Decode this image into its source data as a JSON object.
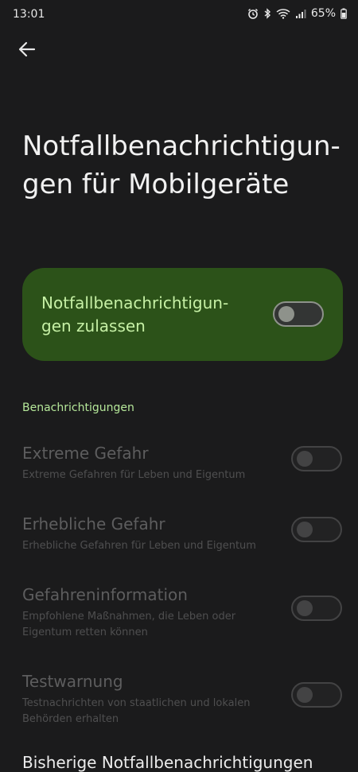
{
  "status_bar": {
    "time": "13:01",
    "battery": "65%",
    "icons": [
      "alarm-icon",
      "bluetooth-icon",
      "wifi-icon",
      "signal-icon",
      "battery-icon"
    ]
  },
  "header": {
    "back_icon": "arrow-left-icon",
    "title": "Notfallbenachrichtigun-\ngen für Mobilgeräte"
  },
  "master": {
    "label": "Notfallbenachrichtigun-\ngen zulassen",
    "enabled": false
  },
  "section": {
    "header": "Benachrichtigungen"
  },
  "settings": [
    {
      "title": "Extreme Gefahr",
      "description": "Extreme Gefahren für Leben und Eigentum",
      "enabled": false
    },
    {
      "title": "Erhebliche Gefahr",
      "description": "Erhebliche Gefahren für Leben und Eigentum",
      "enabled": false
    },
    {
      "title": "Gefahreninformation",
      "description": "Empfohlene Maßnahmen, die Leben oder Eigentum retten können",
      "enabled": false
    },
    {
      "title": "Testwarnung",
      "description": "Testnachrichten von staatlichen und lokalen Behörden erhalten",
      "enabled": false
    }
  ],
  "history": {
    "title": "Bisherige Notfallbenachrichtigungen"
  },
  "colors": {
    "background": "#1b1b1c",
    "accent": "#c6f0a5",
    "card": "#2c5219"
  }
}
